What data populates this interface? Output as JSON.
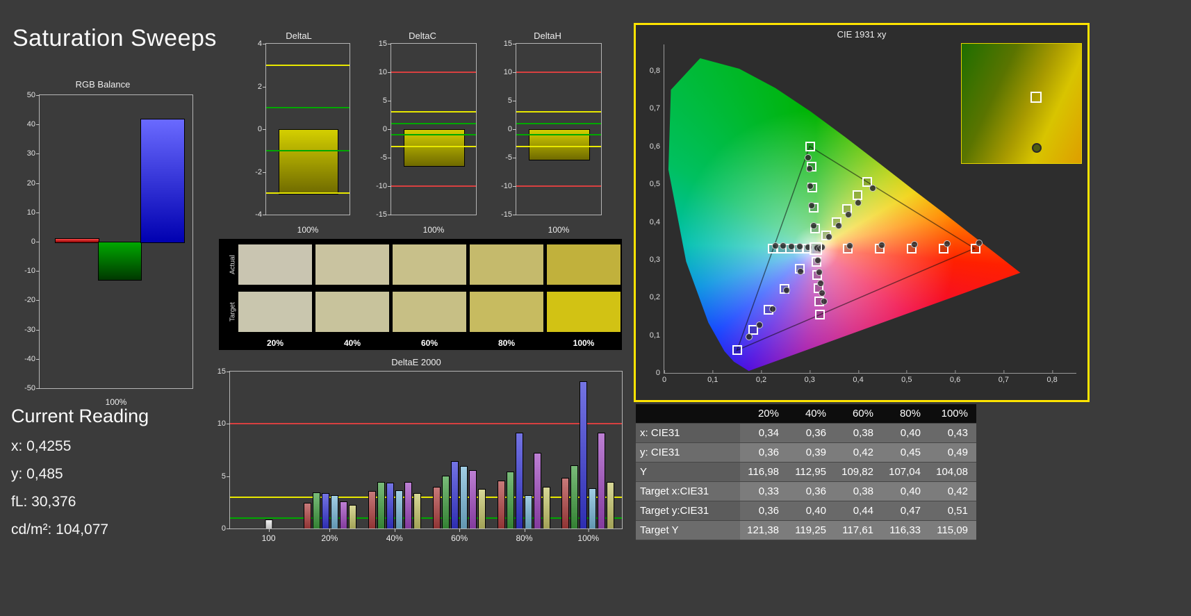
{
  "title": "Saturation Sweeps",
  "current_reading": {
    "heading": "Current Reading",
    "lines": [
      "x: 0,4255",
      "y: 0,485",
      "fL: 30,376",
      "cd/m²: 104,077"
    ]
  },
  "colors": {
    "page_background": "#3b3b3b",
    "cie_panel_border": "#ffe400",
    "swatch_panel_background": "#000000",
    "ref_red": "#d84040",
    "ref_yellow": "#e8e800",
    "ref_green": "#00a800"
  },
  "chart_data": [
    {
      "id": "rgb_balance",
      "type": "bar",
      "title": "RGB Balance",
      "categories": [
        "100%"
      ],
      "xlabel": "100%",
      "ylim": [
        -50,
        50
      ],
      "yticks": [
        50,
        40,
        30,
        20,
        10,
        0,
        -10,
        -20,
        -30,
        -40,
        -50
      ],
      "series": [
        {
          "name": "Red",
          "value": 1.3,
          "gradient": [
            "#ff4848",
            "#8a0000"
          ]
        },
        {
          "name": "Green",
          "value": -12.8,
          "gradient": [
            "#00a800",
            "#003800"
          ]
        },
        {
          "name": "Blue",
          "value": 42,
          "gradient": [
            "#6a6aff",
            "#0000b0"
          ]
        }
      ]
    },
    {
      "id": "deltaL",
      "type": "bar",
      "title": "DeltaL",
      "xlabel": "100%",
      "ylim": [
        -4,
        4
      ],
      "yticks": [
        4,
        2,
        0,
        -2,
        -4
      ],
      "value": -3.0,
      "bar_gradient": [
        "#d4cf00",
        "#6f6a00"
      ],
      "ref_lines": [
        {
          "value": 3,
          "color": "#e8e800"
        },
        {
          "value": 1,
          "color": "#00a800"
        },
        {
          "value": -1,
          "color": "#00a800"
        },
        {
          "value": -3,
          "color": "#e8e800"
        }
      ]
    },
    {
      "id": "deltaC",
      "type": "bar",
      "title": "DeltaC",
      "xlabel": "100%",
      "ylim": [
        -15,
        15
      ],
      "yticks": [
        15,
        10,
        5,
        0,
        -5,
        -10,
        -15
      ],
      "value": -6.3,
      "bar_gradient": [
        "#d4cf00",
        "#6f6a00"
      ],
      "ref_lines": [
        {
          "value": 10,
          "color": "#d84040"
        },
        {
          "value": 3,
          "color": "#e8e800"
        },
        {
          "value": 1,
          "color": "#00a800"
        },
        {
          "value": -1,
          "color": "#00a800"
        },
        {
          "value": -3,
          "color": "#e8e800"
        },
        {
          "value": -10,
          "color": "#d84040"
        }
      ]
    },
    {
      "id": "deltaH",
      "type": "bar",
      "title": "DeltaH",
      "xlabel": "100%",
      "ylim": [
        -15,
        15
      ],
      "yticks": [
        15,
        10,
        5,
        0,
        -5,
        -10,
        -15
      ],
      "value": -5.3,
      "bar_gradient": [
        "#d4cf00",
        "#6f6a00"
      ],
      "ref_lines": [
        {
          "value": 10,
          "color": "#d84040"
        },
        {
          "value": 3,
          "color": "#e8e800"
        },
        {
          "value": 1,
          "color": "#00a800"
        },
        {
          "value": -1,
          "color": "#00a800"
        },
        {
          "value": -3,
          "color": "#e8e800"
        },
        {
          "value": -10,
          "color": "#d84040"
        }
      ]
    },
    {
      "id": "swatches",
      "type": "table",
      "row_labels": [
        "Actual",
        "Target"
      ],
      "col_labels": [
        "20%",
        "40%",
        "60%",
        "80%",
        "100%"
      ],
      "actual_colors": [
        "#c9c5b1",
        "#c9c3a0",
        "#c8c08a",
        "#c5ba6c",
        "#c1b13c"
      ],
      "target_colors": [
        "#c9c6ae",
        "#c8c39c",
        "#c7bf85",
        "#c7bb60",
        "#d2c214"
      ]
    },
    {
      "id": "deltaE2000",
      "type": "bar",
      "title": "DeltaE 2000",
      "ylim": [
        0,
        15
      ],
      "yticks": [
        15,
        10,
        5,
        0
      ],
      "ref_lines": [
        {
          "value": 10,
          "color": "#d84040"
        },
        {
          "value": 3,
          "color": "#e8e800"
        },
        {
          "value": 1,
          "color": "#00a800"
        }
      ],
      "groups": [
        {
          "label": "100",
          "bars": [
            {
              "name": "White",
              "color": "#ececec",
              "value": 0.8
            }
          ]
        },
        {
          "label": "20%",
          "bars": [
            {
              "name": "Red",
              "color": "#b04040",
              "value": 2.4
            },
            {
              "name": "Green",
              "color": "#3f9e3f",
              "value": 3.4
            },
            {
              "name": "Blue",
              "color": "#3838d8",
              "value": 3.3
            },
            {
              "name": "Cyan",
              "color": "#78b8d8",
              "value": 3.1
            },
            {
              "name": "Magenta",
              "color": "#a048c0",
              "value": 2.5
            },
            {
              "name": "Yellow",
              "color": "#c6c66a",
              "value": 2.2
            }
          ]
        },
        {
          "label": "40%",
          "bars": [
            {
              "name": "Red",
              "color": "#b04040",
              "value": 3.5
            },
            {
              "name": "Green",
              "color": "#3f9e3f",
              "value": 4.4
            },
            {
              "name": "Blue",
              "color": "#3838d8",
              "value": 4.3
            },
            {
              "name": "Cyan",
              "color": "#78b8d8",
              "value": 3.6
            },
            {
              "name": "Magenta",
              "color": "#a048c0",
              "value": 4.4
            },
            {
              "name": "Yellow",
              "color": "#c6c66a",
              "value": 3.3
            }
          ]
        },
        {
          "label": "60%",
          "bars": [
            {
              "name": "Red",
              "color": "#b04040",
              "value": 3.9
            },
            {
              "name": "Green",
              "color": "#3f9e3f",
              "value": 5.0
            },
            {
              "name": "Blue",
              "color": "#3838d8",
              "value": 6.4
            },
            {
              "name": "Cyan",
              "color": "#78b8d8",
              "value": 5.9
            },
            {
              "name": "Magenta",
              "color": "#a048c0",
              "value": 5.5
            },
            {
              "name": "Yellow",
              "color": "#c6c66a",
              "value": 3.7
            }
          ]
        },
        {
          "label": "80%",
          "bars": [
            {
              "name": "Red",
              "color": "#b04040",
              "value": 4.5
            },
            {
              "name": "Green",
              "color": "#3f9e3f",
              "value": 5.4
            },
            {
              "name": "Blue",
              "color": "#3838d8",
              "value": 9.1
            },
            {
              "name": "Cyan",
              "color": "#78b8d8",
              "value": 3.1
            },
            {
              "name": "Magenta",
              "color": "#a048c0",
              "value": 7.2
            },
            {
              "name": "Yellow",
              "color": "#c6c66a",
              "value": 3.9
            }
          ]
        },
        {
          "label": "100%",
          "bars": [
            {
              "name": "Red",
              "color": "#b04040",
              "value": 4.8
            },
            {
              "name": "Green",
              "color": "#3f9e3f",
              "value": 6.0
            },
            {
              "name": "Blue",
              "color": "#3838d8",
              "value": 14.0
            },
            {
              "name": "Cyan",
              "color": "#78b8d8",
              "value": 3.8
            },
            {
              "name": "Magenta",
              "color": "#a048c0",
              "value": 9.1
            },
            {
              "name": "Yellow",
              "color": "#c6c66a",
              "value": 4.4
            }
          ]
        }
      ]
    },
    {
      "id": "cie",
      "type": "scatter",
      "title": "CIE 1931 xy",
      "xlim": [
        0,
        0.85
      ],
      "ylim": [
        0,
        0.87
      ],
      "xticks": [
        "0",
        "0,1",
        "0,2",
        "0,3",
        "0,4",
        "0,5",
        "0,6",
        "0,7",
        "0,8"
      ],
      "yticks": [
        "0",
        "0,1",
        "0,2",
        "0,3",
        "0,4",
        "0,5",
        "0,6",
        "0,7",
        "0,8"
      ],
      "white_point": [
        0.3127,
        0.329
      ],
      "gamut_triangle": [
        [
          0.64,
          0.33
        ],
        [
          0.3,
          0.6
        ],
        [
          0.15,
          0.06
        ]
      ],
      "target_squares": [
        [
          0.378,
          0.329
        ],
        [
          0.444,
          0.329
        ],
        [
          0.51,
          0.33
        ],
        [
          0.576,
          0.33
        ],
        [
          0.642,
          0.33
        ],
        [
          0.311,
          0.383
        ],
        [
          0.308,
          0.438
        ],
        [
          0.306,
          0.492
        ],
        [
          0.304,
          0.546
        ],
        [
          0.301,
          0.6
        ],
        [
          0.28,
          0.275
        ],
        [
          0.248,
          0.222
        ],
        [
          0.215,
          0.168
        ],
        [
          0.183,
          0.114
        ],
        [
          0.15,
          0.06
        ],
        [
          0.295,
          0.329
        ],
        [
          0.277,
          0.329
        ],
        [
          0.26,
          0.329
        ],
        [
          0.242,
          0.33
        ],
        [
          0.224,
          0.33
        ],
        [
          0.314,
          0.294
        ],
        [
          0.316,
          0.259
        ],
        [
          0.318,
          0.224
        ],
        [
          0.319,
          0.189
        ],
        [
          0.321,
          0.154
        ],
        [
          0.334,
          0.364
        ],
        [
          0.355,
          0.399
        ],
        [
          0.377,
          0.435
        ],
        [
          0.398,
          0.47
        ],
        [
          0.419,
          0.505
        ]
      ],
      "measured_circles": [
        [
          0.34,
          0.36
        ],
        [
          0.36,
          0.39
        ],
        [
          0.38,
          0.42
        ],
        [
          0.4,
          0.45
        ],
        [
          0.43,
          0.49
        ],
        [
          0.382,
          0.336
        ],
        [
          0.449,
          0.338
        ],
        [
          0.516,
          0.34
        ],
        [
          0.583,
          0.342
        ],
        [
          0.65,
          0.344
        ],
        [
          0.308,
          0.39
        ],
        [
          0.304,
          0.443
        ],
        [
          0.301,
          0.495
        ],
        [
          0.299,
          0.54
        ],
        [
          0.297,
          0.57
        ],
        [
          0.281,
          0.268
        ],
        [
          0.252,
          0.218
        ],
        [
          0.224,
          0.17
        ],
        [
          0.197,
          0.126
        ],
        [
          0.175,
          0.095
        ],
        [
          0.296,
          0.333
        ],
        [
          0.279,
          0.334
        ],
        [
          0.262,
          0.335
        ],
        [
          0.245,
          0.336
        ],
        [
          0.229,
          0.337
        ],
        [
          0.317,
          0.298
        ],
        [
          0.32,
          0.266
        ],
        [
          0.323,
          0.237
        ],
        [
          0.326,
          0.212
        ],
        [
          0.33,
          0.19
        ],
        [
          0.316,
          0.331
        ],
        [
          0.321,
          0.33
        ],
        [
          0.326,
          0.332
        ]
      ],
      "inset": {
        "square_pos": [
          0.62,
          0.45
        ],
        "circle_pos": [
          0.63,
          0.87
        ]
      }
    }
  ],
  "table": {
    "columns": [
      "20%",
      "40%",
      "60%",
      "80%",
      "100%"
    ],
    "rows": [
      {
        "label": "x: CIE31",
        "values": [
          "0,34",
          "0,36",
          "0,38",
          "0,40",
          "0,43"
        ]
      },
      {
        "label": "y: CIE31",
        "values": [
          "0,36",
          "0,39",
          "0,42",
          "0,45",
          "0,49"
        ]
      },
      {
        "label": "Y",
        "values": [
          "116,98",
          "112,95",
          "109,82",
          "107,04",
          "104,08"
        ]
      },
      {
        "label": "Target x:CIE31",
        "values": [
          "0,33",
          "0,36",
          "0,38",
          "0,40",
          "0,42"
        ]
      },
      {
        "label": "Target y:CIE31",
        "values": [
          "0,36",
          "0,40",
          "0,44",
          "0,47",
          "0,51"
        ]
      },
      {
        "label": "Target Y",
        "values": [
          "121,38",
          "119,25",
          "117,61",
          "116,33",
          "115,09"
        ]
      }
    ]
  }
}
